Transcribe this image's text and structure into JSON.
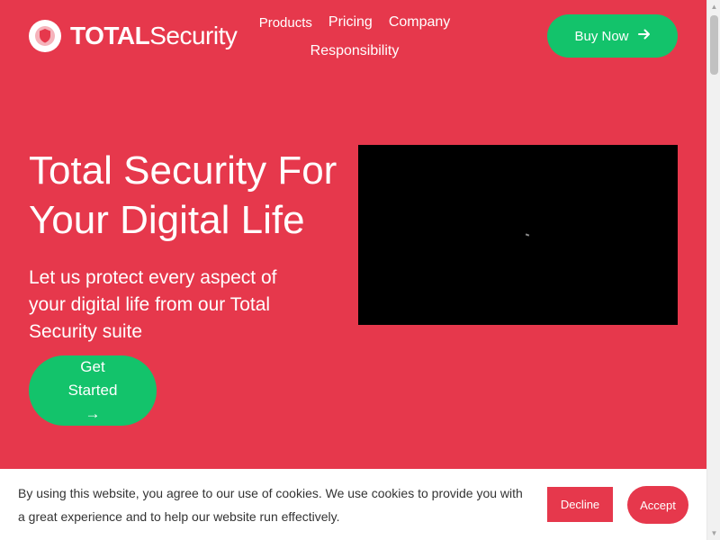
{
  "brand": {
    "name_bold": "TOTAL",
    "name_light": "Security",
    "logo_icon": "shield-icon"
  },
  "nav": {
    "items": [
      {
        "label": "Products"
      },
      {
        "label": "Pricing"
      },
      {
        "label": "Company"
      },
      {
        "label": "Responsibility"
      }
    ]
  },
  "header": {
    "buy_label": "Buy Now",
    "buy_icon": "arrow-right-icon"
  },
  "hero": {
    "title_line1": "Total Security For",
    "title_line2": "Your Digital Life",
    "subtitle_line1": "Let us protect every aspect of",
    "subtitle_line2": "your digital life from our Total",
    "subtitle_line3": "Security suite",
    "cta_line1": "Get",
    "cta_line2": "Started",
    "cta_line3": "→"
  },
  "cookie": {
    "text_line1": "By using this website, you agree to our use of cookies. We use cookies to provide you with",
    "text_line2": "a great experience and to help our website run effectively.",
    "decline_label": "Decline",
    "accept_label": "Accept"
  },
  "colors": {
    "brand_red": "#e6384c",
    "accent_green": "#13c36b",
    "white": "#ffffff"
  }
}
